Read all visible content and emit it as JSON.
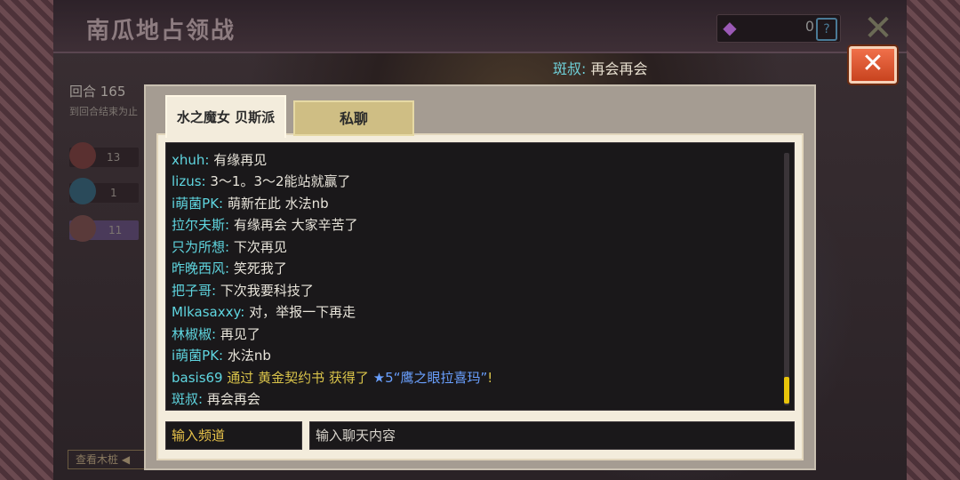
{
  "game": {
    "title": "南瓜地占领战",
    "currency_value": "0",
    "currency_icon": "crystal-icon",
    "help_icon": "question-icon",
    "round_label": "回合 165",
    "round_sub": "到回合结束为止（",
    "teams": [
      {
        "value": "13"
      },
      {
        "value": "1"
      },
      {
        "value": "11"
      }
    ],
    "bg_button": "查看木桩 ◀"
  },
  "announcement": {
    "user": "斑叔:",
    "message": "再会再会"
  },
  "close_icon": "✕",
  "tabs": [
    {
      "label": "水之魔女 贝斯派",
      "active": true
    },
    {
      "label": "私聊",
      "active": false
    }
  ],
  "messages": [
    {
      "user": "xhuh:",
      "text": "有缘再见"
    },
    {
      "user": "lizus:",
      "text": "3～1。3～2能站就赢了"
    },
    {
      "user": "i萌菌PK:",
      "text": "萌新在此 水法nb"
    },
    {
      "user": "拉尔夫斯:",
      "text": "有缘再会 大家辛苦了"
    },
    {
      "user": "只为所想:",
      "text": "下次再见"
    },
    {
      "user": "昨晚西风:",
      "text": "笑死我了"
    },
    {
      "user": "把子哥:",
      "text": "下次我要科技了"
    },
    {
      "user": "Mlkasaxxy:",
      "text": "对，举报一下再走"
    },
    {
      "user": "林椒椒:",
      "text": "再见了"
    },
    {
      "user": "i萌菌PK:",
      "text": "水法nb"
    },
    {
      "user": "basis69",
      "system": true,
      "pre": "通过 黄金契约书 获得了",
      "item": "★5“鹰之眼拉喜玛”",
      "post": "!"
    },
    {
      "user": "斑叔:",
      "text": "再会再会"
    }
  ],
  "inputs": {
    "channel_placeholder": "输入频道",
    "chat_placeholder": "输入聊天内容"
  },
  "colors": {
    "username": "#5fd6e0",
    "system_text": "#d9c34a",
    "item_text": "#6aa0ff",
    "scroll_thumb": "#e8c40a",
    "close_button": "#e35a33"
  }
}
